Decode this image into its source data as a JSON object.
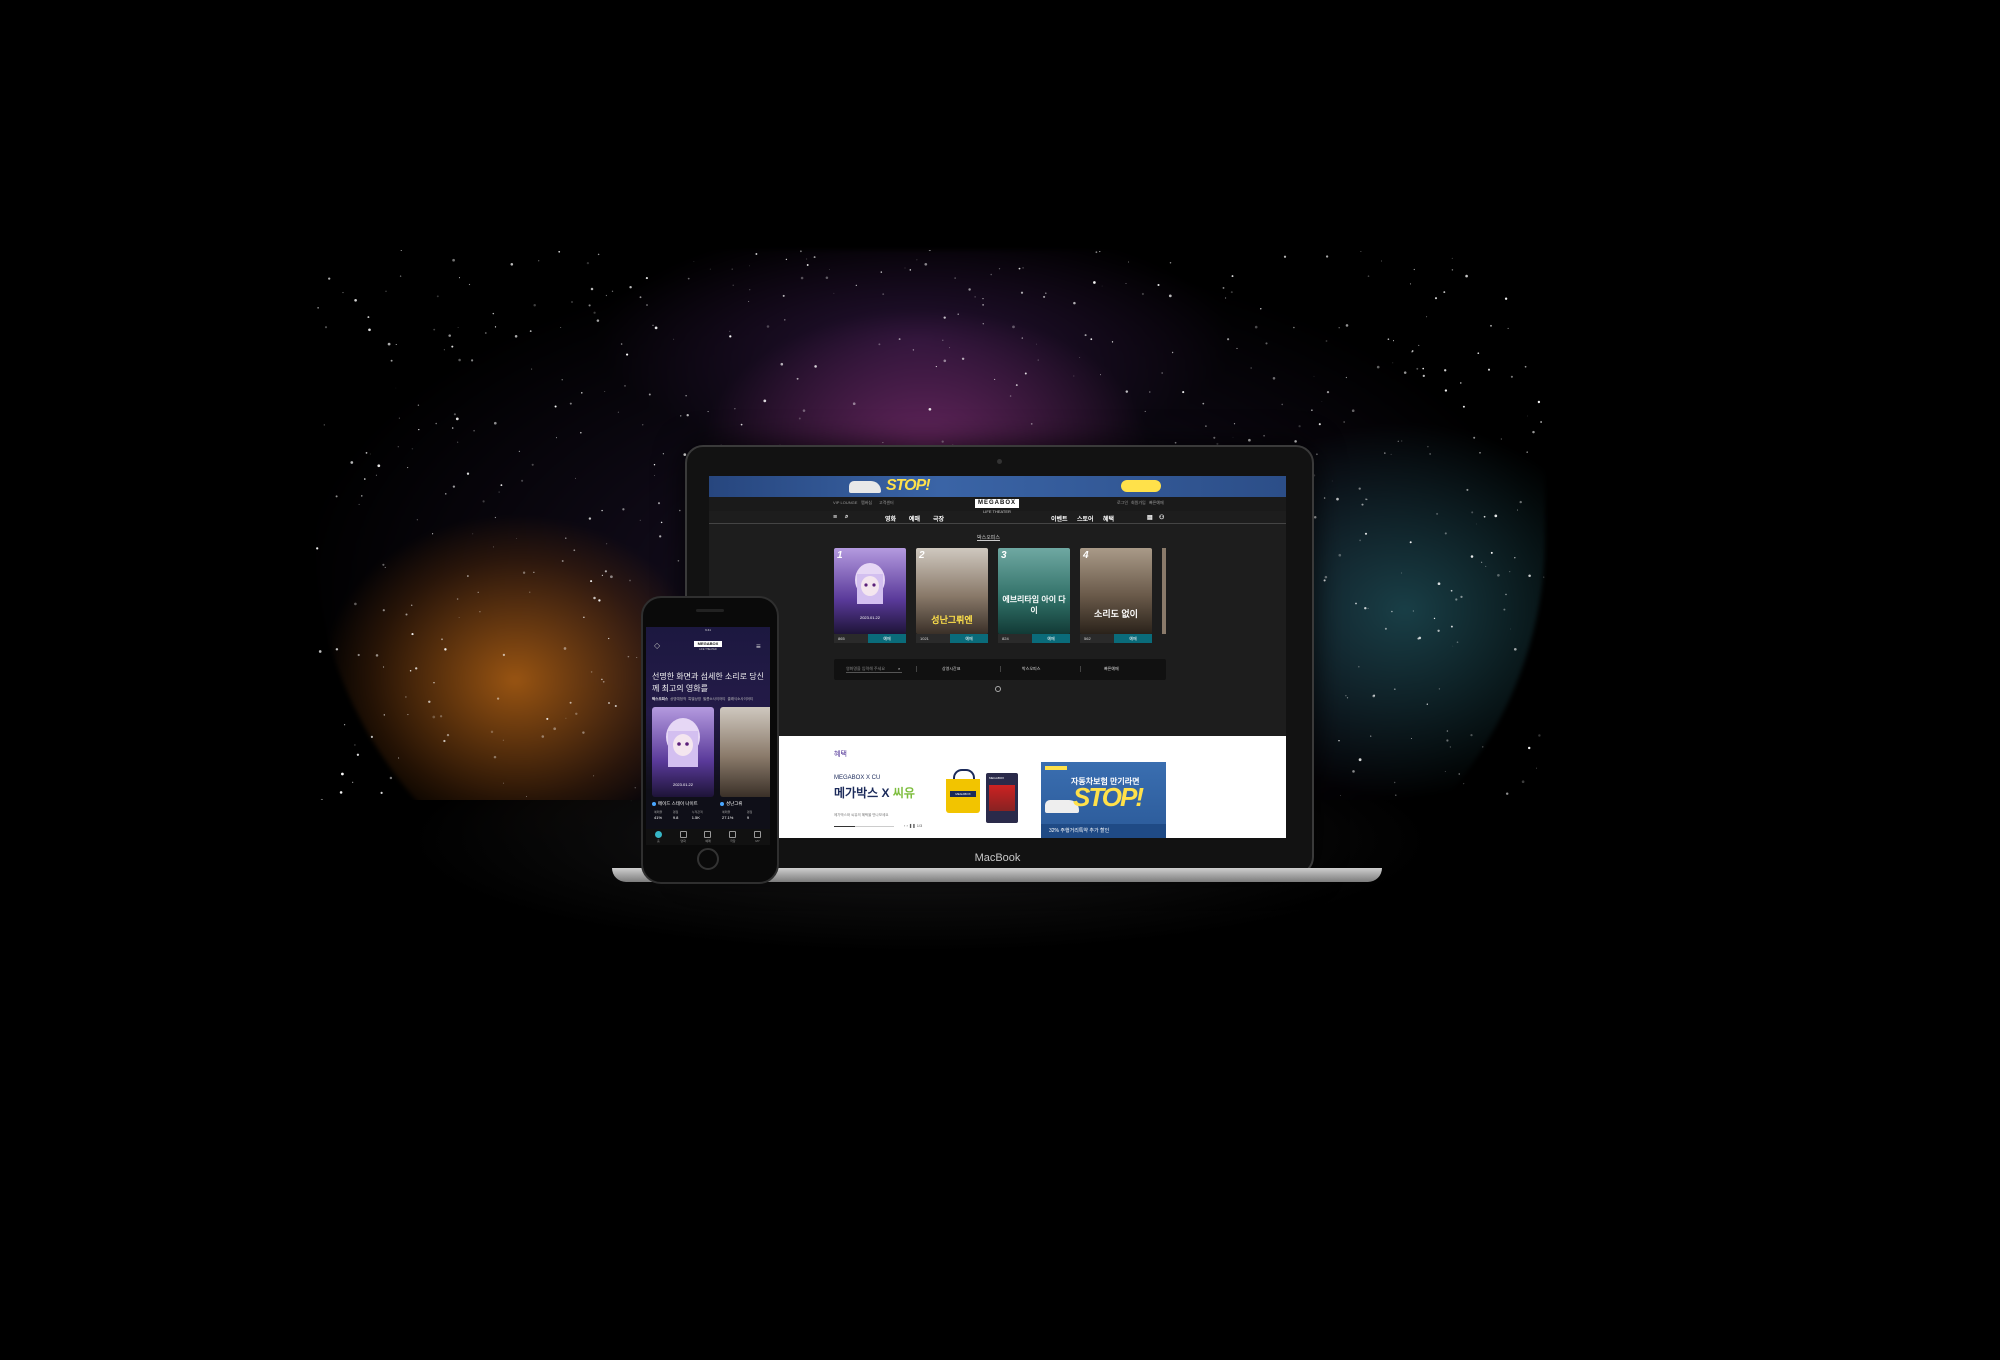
{
  "laptop": {
    "brand_label": "MacBook",
    "site": {
      "ad_banner": {
        "headline": "STOP!",
        "button_label": ""
      },
      "utility_links_left": [
        "VIP LOUNGE",
        "멤버십",
        "고객센터"
      ],
      "utility_links_right": [
        "로그인",
        "회원가입",
        "빠른예매"
      ],
      "logo": "MEGABOX",
      "logo_sub": "LIFE THEATER",
      "nav_left": [
        "영화",
        "예매",
        "극장"
      ],
      "nav_right": [
        "이벤트",
        "스토어",
        "혜택"
      ],
      "section_title": "박스오피스",
      "movies": [
        {
          "rank": "1",
          "title": "",
          "date": "2023.01.22",
          "likes": "865",
          "book": "예매",
          "theme": "#5a3a9a"
        },
        {
          "rank": "2",
          "title": "성난그뤼엔",
          "date": "",
          "likes": "1021",
          "book": "예매",
          "theme": "#8a7a6a"
        },
        {
          "rank": "3",
          "title": "에브리타임 아이 다이",
          "date": "",
          "likes": "824",
          "book": "예매",
          "theme": "#2f6f66"
        },
        {
          "rank": "4",
          "title": "소리도 없이",
          "date": "",
          "likes": "562",
          "book": "예매",
          "theme": "#6a5a4a"
        }
      ],
      "quick_bar": {
        "search_placeholder": "영화명을 입력해 주세요",
        "items": [
          "상영시간표",
          "박스오피스",
          "빠른예매"
        ]
      },
      "benefit_title": "혜택",
      "collab": {
        "subtitle": "MEGABOX X CU",
        "title_main": "메가박스 X ",
        "title_accent": "씨유",
        "description": "메가박스와 씨유의 혜택을 만나보세요",
        "controls": "‹ › ❚❚ 1/3",
        "progress": 0.35,
        "tote_label": "MEGABOX",
        "giftcard_brand": "MEGABOX"
      },
      "side_ad": {
        "top_text": "자동차보험 만기라면",
        "headline": "STOP!",
        "footer": "32% 주행거리특약 추가 할인"
      }
    }
  },
  "phone": {
    "status": "9:41",
    "logo": "MEGABOX",
    "logo_sub": "LIFE THEATER",
    "headline": "선명한 화면과 섬세한 소리로 당신께 최고의 영화를",
    "tabs": [
      "박스오피스",
      "상영예정작",
      "특별상영",
      "필름소사이어티",
      "클래식소사이어티"
    ],
    "posters": [
      {
        "date": "2023.01.22",
        "name": "메이드 스테이 나이트",
        "stats": [
          [
            "예매율",
            "41%"
          ],
          [
            "평점",
            "9.8"
          ],
          [
            "누적관객",
            "1.5K"
          ]
        ]
      },
      {
        "date": "",
        "name": "성난그뤼",
        "stats": [
          [
            "예매율",
            "27.1%"
          ],
          [
            "평점",
            "9"
          ]
        ]
      }
    ],
    "tabbar": [
      "홈",
      "영화",
      "예매",
      "극장",
      "MY"
    ]
  },
  "colors": {
    "accent_purple": "#503396",
    "teal_button": "#0a6b7a",
    "ad_yellow": "#ffe14a",
    "cu_green": "#7cbd3c"
  }
}
